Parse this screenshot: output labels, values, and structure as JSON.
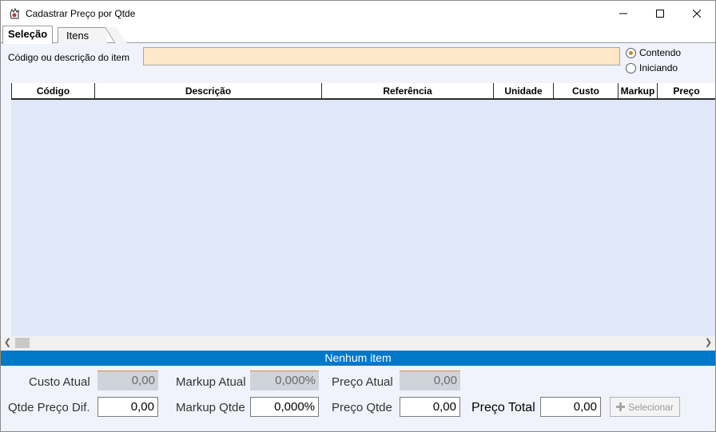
{
  "window": {
    "title": "Cadastrar Preço por Qtde"
  },
  "tabs": [
    {
      "label": "Seleção",
      "active": true
    },
    {
      "label": "Itens",
      "active": false
    }
  ],
  "search": {
    "label": "Código ou descrição do item",
    "value": "",
    "mode_options": [
      {
        "label": "Contendo",
        "checked": true
      },
      {
        "label": "Iniciando",
        "checked": false
      }
    ]
  },
  "grid": {
    "columns": [
      "Código",
      "Descrição",
      "Referência",
      "Unidade",
      "Custo",
      "Markup",
      "Preço"
    ],
    "rows": []
  },
  "status": {
    "text": "Nenhum item"
  },
  "fields": {
    "custo_atual": {
      "label": "Custo Atual",
      "value": "0,00"
    },
    "markup_atual": {
      "label": "Markup Atual",
      "value": "0,000%"
    },
    "preco_atual": {
      "label": "Preço Atual",
      "value": "0,00"
    },
    "qtde_preco_dif": {
      "label": "Qtde Preço Dif.",
      "value": "0,00"
    },
    "markup_qtde": {
      "label": "Markup Qtde",
      "value": "0,000%"
    },
    "preco_qtde": {
      "label": "Preço Qtde",
      "value": "0,00"
    },
    "preco_total": {
      "label": "Preço Total",
      "value": "0,00"
    }
  },
  "buttons": {
    "selecionar": "Selecionar"
  },
  "colors": {
    "accent": "#0078c8",
    "search_bg": "#fde8c8",
    "grid_bg": "#dfe7f8"
  }
}
